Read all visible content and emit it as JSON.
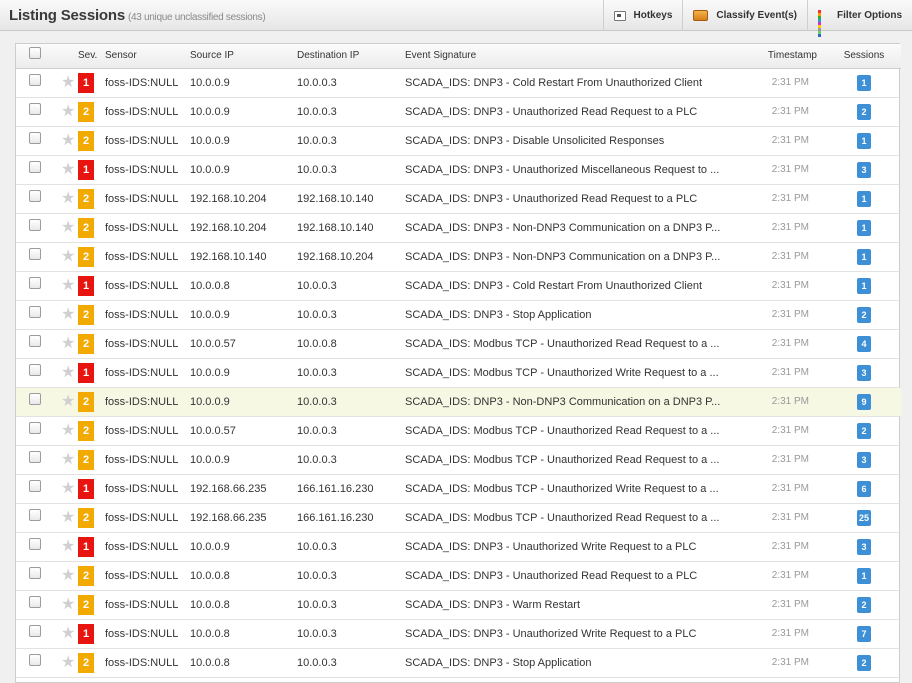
{
  "header": {
    "title": "Listing Sessions",
    "subtitle": "(43 unique unclassified sessions)",
    "toolbar": {
      "hotkeys": "Hotkeys",
      "classify": "Classify Event(s)",
      "filter": "Filter Options"
    }
  },
  "columns": {
    "sev": "Sev.",
    "sensor": "Sensor",
    "src": "Source IP",
    "dst": "Destination IP",
    "sig": "Event Signature",
    "ts": "Timestamp",
    "sessions": "Sessions"
  },
  "colors": {
    "sev1": "#e8140f",
    "sev2": "#f2a900",
    "sessionBadge": "#3d8fd6",
    "highlightRow": "#f7f8e4"
  },
  "rows": [
    {
      "sev": "1",
      "sensor": "foss-IDS:NULL",
      "src": "10.0.0.9",
      "dst": "10.0.0.3",
      "sig": "SCADA_IDS: DNP3 - Cold Restart From Unauthorized Client",
      "ts": "2:31 PM",
      "sessions": "1"
    },
    {
      "sev": "2",
      "sensor": "foss-IDS:NULL",
      "src": "10.0.0.9",
      "dst": "10.0.0.3",
      "sig": "SCADA_IDS: DNP3 - Unauthorized Read Request to a PLC",
      "ts": "2:31 PM",
      "sessions": "2"
    },
    {
      "sev": "2",
      "sensor": "foss-IDS:NULL",
      "src": "10.0.0.9",
      "dst": "10.0.0.3",
      "sig": "SCADA_IDS: DNP3 - Disable Unsolicited Responses",
      "ts": "2:31 PM",
      "sessions": "1"
    },
    {
      "sev": "1",
      "sensor": "foss-IDS:NULL",
      "src": "10.0.0.9",
      "dst": "10.0.0.3",
      "sig": "SCADA_IDS: DNP3 - Unauthorized Miscellaneous Request to ...",
      "ts": "2:31 PM",
      "sessions": "3"
    },
    {
      "sev": "2",
      "sensor": "foss-IDS:NULL",
      "src": "192.168.10.204",
      "dst": "192.168.10.140",
      "sig": "SCADA_IDS: DNP3 - Unauthorized Read Request to a PLC",
      "ts": "2:31 PM",
      "sessions": "1"
    },
    {
      "sev": "2",
      "sensor": "foss-IDS:NULL",
      "src": "192.168.10.204",
      "dst": "192.168.10.140",
      "sig": "SCADA_IDS: DNP3 - Non-DNP3 Communication on a DNP3 P...",
      "ts": "2:31 PM",
      "sessions": "1"
    },
    {
      "sev": "2",
      "sensor": "foss-IDS:NULL",
      "src": "192.168.10.140",
      "dst": "192.168.10.204",
      "sig": "SCADA_IDS: DNP3 - Non-DNP3 Communication on a DNP3 P...",
      "ts": "2:31 PM",
      "sessions": "1"
    },
    {
      "sev": "1",
      "sensor": "foss-IDS:NULL",
      "src": "10.0.0.8",
      "dst": "10.0.0.3",
      "sig": "SCADA_IDS: DNP3 - Cold Restart From Unauthorized Client",
      "ts": "2:31 PM",
      "sessions": "1"
    },
    {
      "sev": "2",
      "sensor": "foss-IDS:NULL",
      "src": "10.0.0.9",
      "dst": "10.0.0.3",
      "sig": "SCADA_IDS: DNP3 - Stop Application",
      "ts": "2:31 PM",
      "sessions": "2"
    },
    {
      "sev": "2",
      "sensor": "foss-IDS:NULL",
      "src": "10.0.0.57",
      "dst": "10.0.0.8",
      "sig": "SCADA_IDS: Modbus TCP - Unauthorized Read Request to a ...",
      "ts": "2:31 PM",
      "sessions": "4"
    },
    {
      "sev": "1",
      "sensor": "foss-IDS:NULL",
      "src": "10.0.0.9",
      "dst": "10.0.0.3",
      "sig": "SCADA_IDS: Modbus TCP - Unauthorized Write Request to a ...",
      "ts": "2:31 PM",
      "sessions": "3"
    },
    {
      "sev": "2",
      "sensor": "foss-IDS:NULL",
      "src": "10.0.0.9",
      "dst": "10.0.0.3",
      "sig": "SCADA_IDS: DNP3 - Non-DNP3 Communication on a DNP3 P...",
      "ts": "2:31 PM",
      "sessions": "9",
      "highlight": true
    },
    {
      "sev": "2",
      "sensor": "foss-IDS:NULL",
      "src": "10.0.0.57",
      "dst": "10.0.0.3",
      "sig": "SCADA_IDS: Modbus TCP - Unauthorized Read Request to a ...",
      "ts": "2:31 PM",
      "sessions": "2"
    },
    {
      "sev": "2",
      "sensor": "foss-IDS:NULL",
      "src": "10.0.0.9",
      "dst": "10.0.0.3",
      "sig": "SCADA_IDS: Modbus TCP - Unauthorized Read Request to a ...",
      "ts": "2:31 PM",
      "sessions": "3"
    },
    {
      "sev": "1",
      "sensor": "foss-IDS:NULL",
      "src": "192.168.66.235",
      "dst": "166.161.16.230",
      "sig": "SCADA_IDS: Modbus TCP - Unauthorized Write Request to a ...",
      "ts": "2:31 PM",
      "sessions": "6"
    },
    {
      "sev": "2",
      "sensor": "foss-IDS:NULL",
      "src": "192.168.66.235",
      "dst": "166.161.16.230",
      "sig": "SCADA_IDS: Modbus TCP - Unauthorized Read Request to a ...",
      "ts": "2:31 PM",
      "sessions": "25"
    },
    {
      "sev": "1",
      "sensor": "foss-IDS:NULL",
      "src": "10.0.0.9",
      "dst": "10.0.0.3",
      "sig": "SCADA_IDS: DNP3 - Unauthorized Write Request to a PLC",
      "ts": "2:31 PM",
      "sessions": "3"
    },
    {
      "sev": "2",
      "sensor": "foss-IDS:NULL",
      "src": "10.0.0.8",
      "dst": "10.0.0.3",
      "sig": "SCADA_IDS: DNP3 - Unauthorized Read Request to a PLC",
      "ts": "2:31 PM",
      "sessions": "1"
    },
    {
      "sev": "2",
      "sensor": "foss-IDS:NULL",
      "src": "10.0.0.8",
      "dst": "10.0.0.3",
      "sig": "SCADA_IDS: DNP3 - Warm Restart",
      "ts": "2:31 PM",
      "sessions": "2"
    },
    {
      "sev": "1",
      "sensor": "foss-IDS:NULL",
      "src": "10.0.0.8",
      "dst": "10.0.0.3",
      "sig": "SCADA_IDS: DNP3 - Unauthorized Write Request to a PLC",
      "ts": "2:31 PM",
      "sessions": "7"
    },
    {
      "sev": "2",
      "sensor": "foss-IDS:NULL",
      "src": "10.0.0.8",
      "dst": "10.0.0.3",
      "sig": "SCADA_IDS: DNP3 - Stop Application",
      "ts": "2:31 PM",
      "sessions": "2"
    }
  ]
}
